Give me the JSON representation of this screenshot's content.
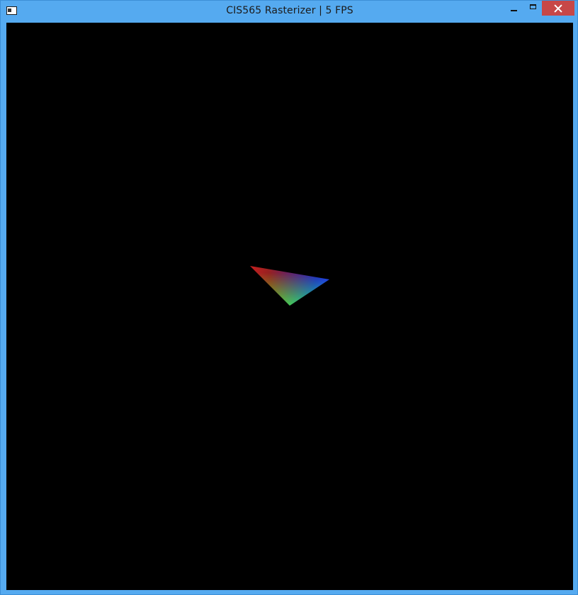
{
  "window": {
    "title": "CIS565 Rasterizer | 5 FPS"
  },
  "viewport": {
    "background": "#000000"
  },
  "triangle": {
    "vertex_colors": [
      "#ff0000",
      "#0000ff",
      "#00ff00"
    ]
  },
  "icons": {
    "app": "window-app-icon",
    "minimize": "minimize-icon",
    "maximize": "maximize-icon",
    "close": "close-icon"
  },
  "colors": {
    "frame": "#55aaf0",
    "close_button": "#c74747"
  }
}
